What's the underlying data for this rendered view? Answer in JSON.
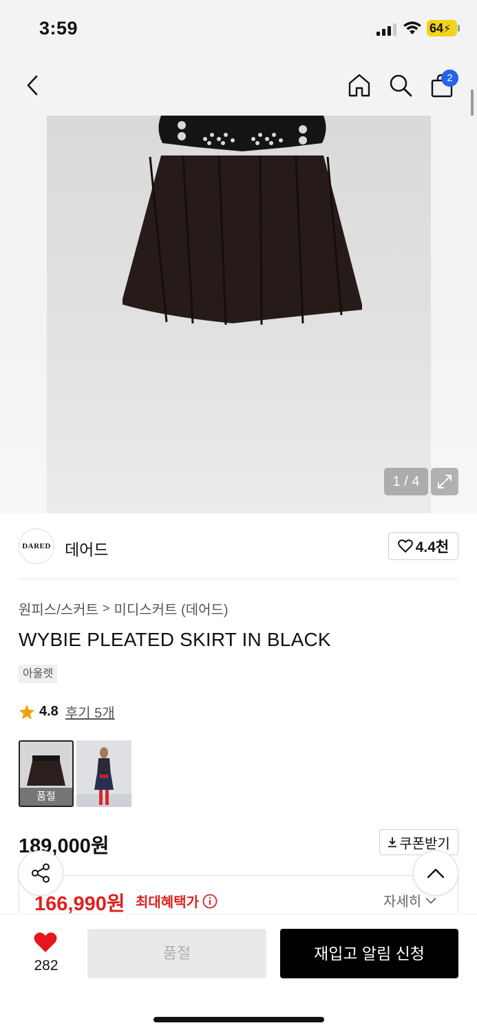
{
  "status_bar": {
    "time": "3:59",
    "battery": "64"
  },
  "header": {
    "cart_count": "2"
  },
  "gallery": {
    "counter": "1 / 4"
  },
  "brand": {
    "logo_text": "DARED",
    "name": "데어드",
    "likes": "4.4천"
  },
  "breadcrumb": {
    "category": "원피스/스커트",
    "subcategory": "미디스커트 (데어드)",
    "separator": ">"
  },
  "product": {
    "title": "WYBIE PLEATED SKIRT IN BLACK",
    "tag": "아울렛",
    "rating": "4.8",
    "review_link": "후기 5개"
  },
  "thumbnails": [
    {
      "label": "품절",
      "selected": true
    },
    {
      "label": "",
      "selected": false
    }
  ],
  "price": {
    "regular": "189,000원",
    "coupon_button": "쿠폰받기",
    "benefit_price": "166,990원",
    "benefit_label": "최대혜택가",
    "detail_link": "자세히"
  },
  "bottom_bar": {
    "wish_count": "282",
    "soldout_button": "품절",
    "restock_button": "재입고 알림 신청"
  },
  "colors": {
    "accent_red": "#e0201c",
    "badge_blue": "#2563eb",
    "battery_yellow": "#f2d21b"
  },
  "icons": [
    "back-icon",
    "home-icon",
    "search-icon",
    "cart-icon",
    "expand-icon",
    "heart-outline-icon",
    "star-icon",
    "download-icon",
    "info-icon",
    "chevron-down-icon",
    "share-icon",
    "chevron-up-icon",
    "heart-filled-icon"
  ]
}
